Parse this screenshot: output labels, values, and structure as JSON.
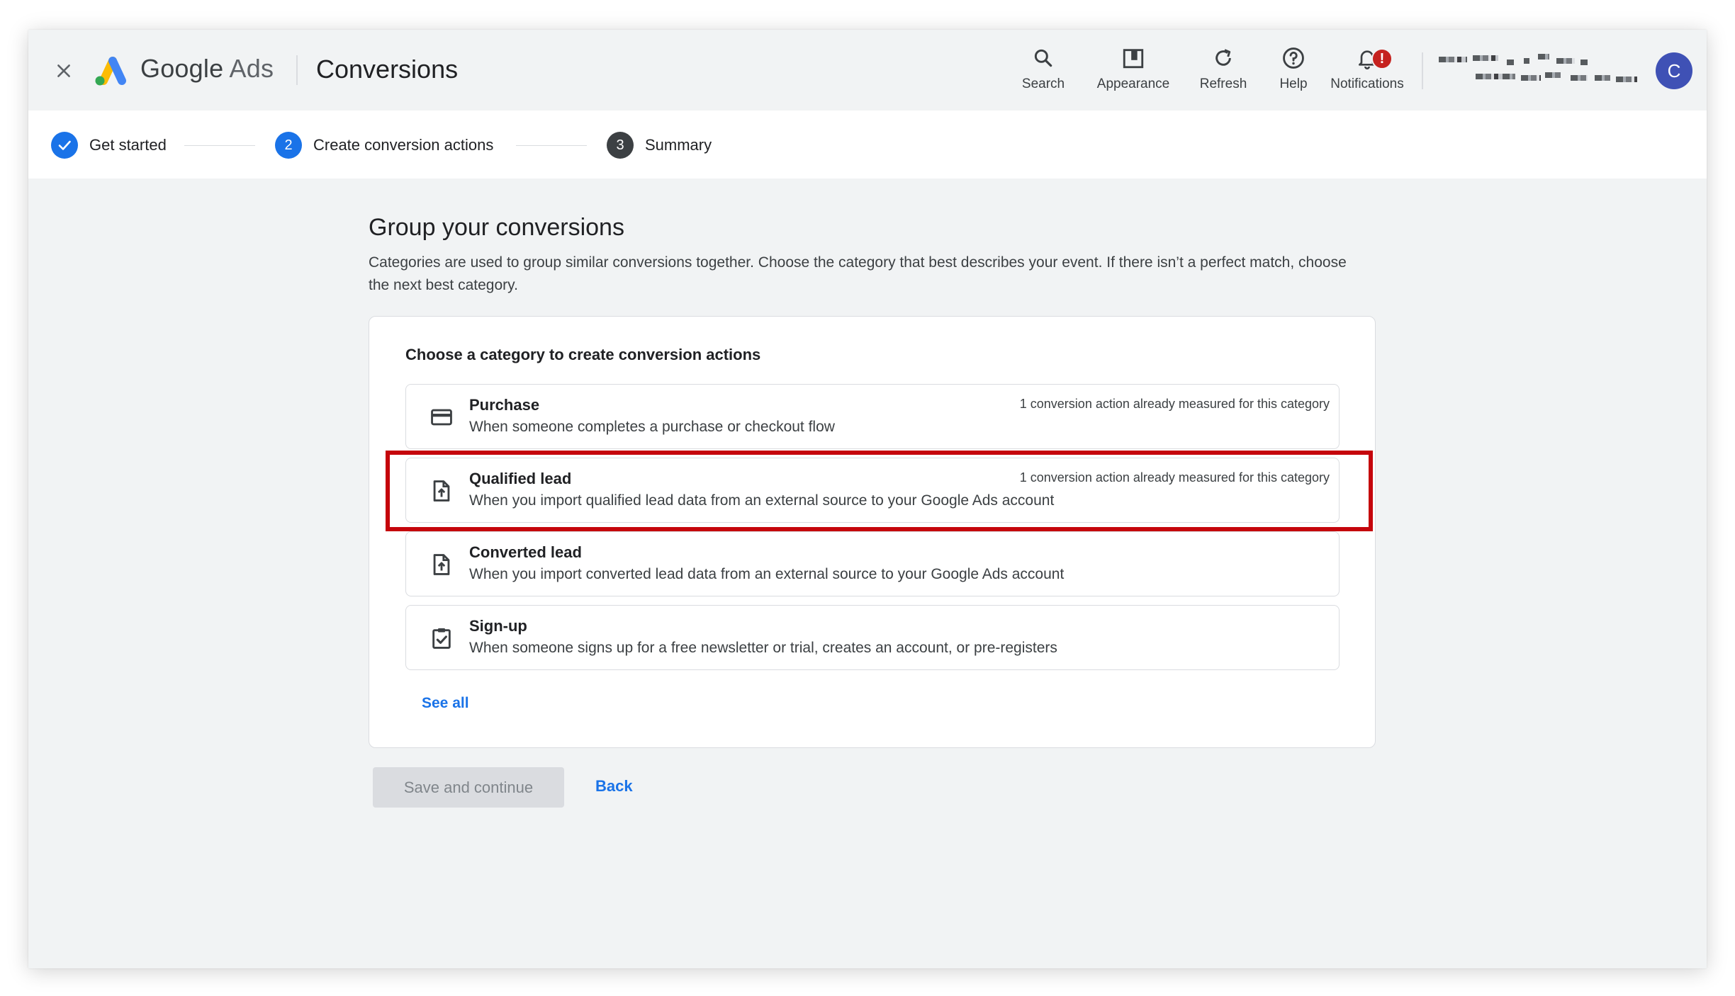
{
  "header": {
    "product_google": "Google",
    "product_ads": "Ads",
    "page_title": "Conversions",
    "tools": [
      {
        "label": "Search",
        "icon": "search-icon"
      },
      {
        "label": "Appearance",
        "icon": "appearance-icon"
      },
      {
        "label": "Refresh",
        "icon": "refresh-icon"
      },
      {
        "label": "Help",
        "icon": "help-icon"
      },
      {
        "label": "Notifications",
        "icon": "bell-icon"
      }
    ],
    "notification_badge": "!",
    "avatar_initial": "C"
  },
  "stepper": {
    "steps": [
      {
        "number": "",
        "label": "Get started",
        "state": "done"
      },
      {
        "number": "2",
        "label": "Create conversion actions",
        "state": "active"
      },
      {
        "number": "3",
        "label": "Summary",
        "state": "todo"
      }
    ]
  },
  "main": {
    "title": "Group your conversions",
    "description": "Categories are used to group similar conversions together. Choose the category that best describes your event. If there isn’t a perfect match, choose the next best category."
  },
  "card": {
    "heading": "Choose a category to create conversion actions",
    "options": [
      {
        "title": "Purchase",
        "description": "When someone completes a purchase or checkout flow",
        "note": "1 conversion action already measured for this category",
        "icon": "credit-card-icon"
      },
      {
        "title": "Qualified lead",
        "description": "When you import qualified lead data from an external source to your Google Ads account",
        "note": "1 conversion action already measured for this category",
        "icon": "file-upload-icon"
      },
      {
        "title": "Converted lead",
        "description": "When you import converted lead data from an external source to your Google Ads account",
        "note": "",
        "icon": "file-upload-icon"
      },
      {
        "title": "Sign-up",
        "description": "When someone signs up for a free newsletter or trial, creates an account, or pre-registers",
        "note": "",
        "icon": "clipboard-check-icon"
      }
    ],
    "see_all": "See all"
  },
  "footer": {
    "save_label": "Save and continue",
    "back_label": "Back"
  },
  "colors": {
    "accent": "#1a73e8",
    "highlight": "#c5050c",
    "avatar": "#3f51b5",
    "badge": "#c5221f"
  }
}
